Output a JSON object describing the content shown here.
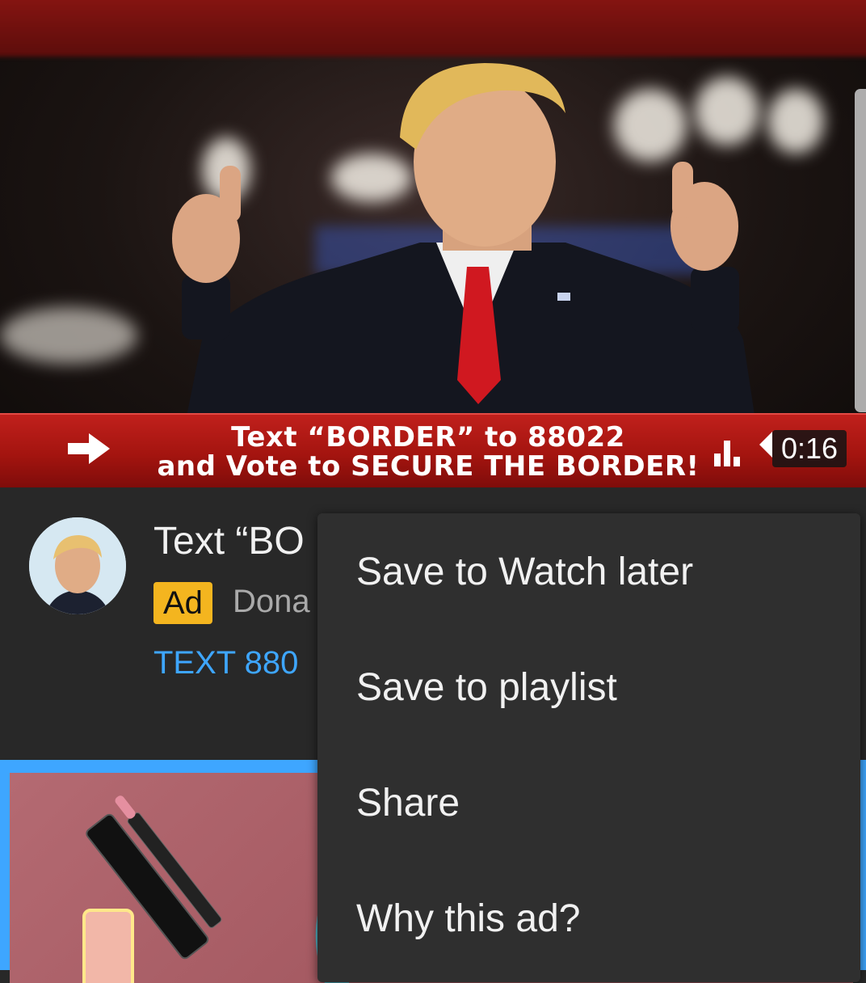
{
  "video": {
    "banner_line1": "Text “BORDER” to 88022",
    "banner_line2": "and Vote to SECURE THE BORDER!",
    "duration": "0:16"
  },
  "ad": {
    "title": "Text “BO",
    "badge": "Ad",
    "advertiser": "Dona",
    "cta": "TEXT 880"
  },
  "menu": {
    "items": [
      {
        "label": "Save to Watch later"
      },
      {
        "label": "Save to playlist"
      },
      {
        "label": "Share"
      },
      {
        "label": "Why this ad?"
      }
    ]
  },
  "colors": {
    "background": "#282828",
    "menu_background": "#2f2f2f",
    "banner_red": "#b0160f",
    "ad_badge": "#f4b51f",
    "link_blue": "#3ea6ff"
  },
  "icons": [
    "arrow-right-icon",
    "equalizer-icon",
    "volume-icon"
  ]
}
